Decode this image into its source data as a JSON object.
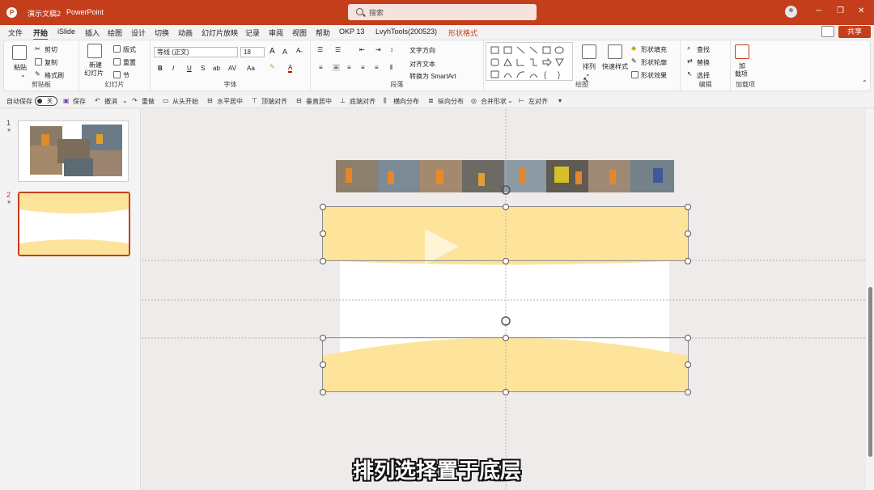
{
  "titlebar": {
    "doc_name": "演示文稿2",
    "app_name": "PowerPoint",
    "search_placeholder": "搜索",
    "minimize": "─",
    "restore": "❐",
    "close": "✕"
  },
  "tabs": [
    "文件",
    "开始",
    "iSlide",
    "插入",
    "绘图",
    "设计",
    "切换",
    "动画",
    "幻灯片放映",
    "记录",
    "审阅",
    "视图",
    "帮助",
    "OKP 13",
    "LvyhTools(200523)",
    "形状格式"
  ],
  "share_label": "共享",
  "ribbon": {
    "clipboard": {
      "paste": "粘贴",
      "cut": "剪切",
      "copy": "复制",
      "format_painter": "格式刷",
      "label": "剪贴板"
    },
    "slides": {
      "new_slide_1": "新建",
      "new_slide_2": "幻灯片",
      "layout": "版式",
      "reset": "重置",
      "section": "节",
      "label": "幻灯片"
    },
    "font": {
      "font_name": "等线 (正文)",
      "font_size": "18",
      "bold": "B",
      "italic": "I",
      "underline": "U",
      "strike": "S",
      "shadow": "ab",
      "spacing": "AV",
      "case": "Aa",
      "grow": "A",
      "shrink": "A",
      "label": "字体"
    },
    "paragraph": {
      "text_direction": "文字方向",
      "align_text": "对齐文本",
      "smartart": "转换为 SmartArt",
      "label": "段落"
    },
    "drawing": {
      "arrange": "排列",
      "quick_styles": "快速样式",
      "shape_fill": "形状填充",
      "shape_outline": "形状轮廓",
      "shape_effects": "形状效果",
      "label": "绘图"
    },
    "editing": {
      "find": "查找",
      "replace": "替换",
      "select": "选择",
      "label": "编辑"
    },
    "addins": {
      "addin_1": "加",
      "addin_2": "载项",
      "label": "加载项"
    }
  },
  "qat": {
    "autosave": "自动保存",
    "autosave_state": "关",
    "save": "保存",
    "undo": "撤消",
    "redo": "重做",
    "from_start": "从头开始",
    "center_h": "水平居中",
    "align_top": "顶端对齐",
    "center_v": "垂直居中",
    "align_bottom": "底端对齐",
    "dist_h": "横向分布",
    "dist_v": "纵向分布",
    "merge_shapes": "合并形状",
    "align_left": "左对齐"
  },
  "slides": [
    {
      "number": "1",
      "star": "★"
    },
    {
      "number": "2",
      "star": "★"
    }
  ],
  "subtitle": "排列选择置于底层",
  "colors": {
    "accent": "#c43e1c",
    "shape_fill": "#fde49a"
  }
}
